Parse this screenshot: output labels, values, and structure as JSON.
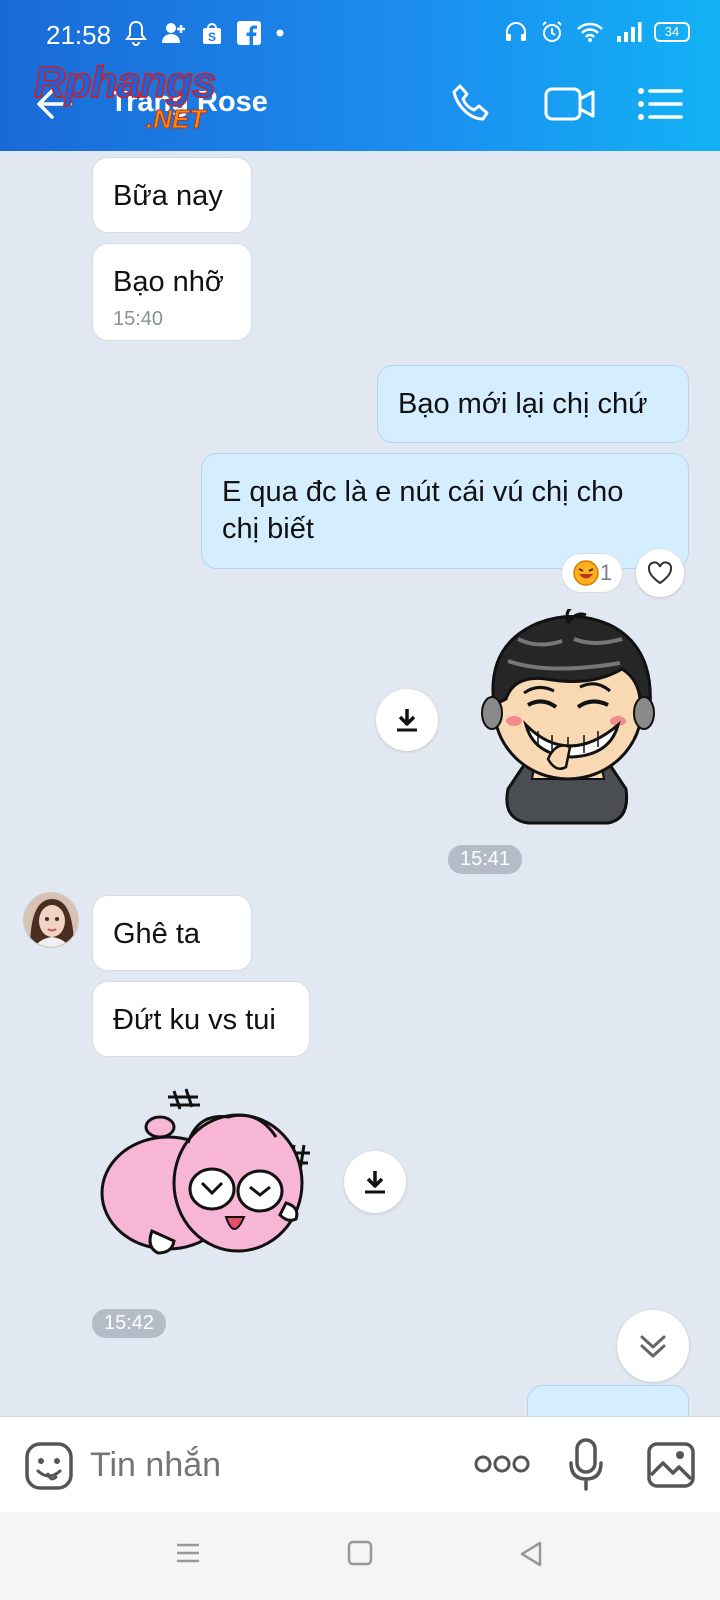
{
  "status_bar": {
    "time": "21:58",
    "battery": "34",
    "left_icons": [
      "bell-icon",
      "add-contact-icon",
      "shopee-icon",
      "facebook-icon",
      "dot-icon"
    ],
    "right_icons": [
      "headset-icon",
      "alarm-icon",
      "wifi-icon",
      "signal-icon",
      "battery-icon"
    ]
  },
  "header": {
    "contact_name": "Trang Rose",
    "watermark_main": "Rphangs",
    "watermark_net": ".NET",
    "accent_color": "#1b8ff0"
  },
  "messages": [
    {
      "text": "Bữa nay",
      "direction": "in"
    },
    {
      "text": "Bạo nhỡ",
      "direction": "in",
      "time": "15:40"
    },
    {
      "text": "Bạo mới lại chị chứ",
      "direction": "out"
    },
    {
      "text": "E qua đc là e nút cái vú chị cho chị biết",
      "direction": "out",
      "reaction_count": "1"
    },
    {
      "type": "sticker",
      "direction": "out",
      "description_icon": "smirking-boy-sticker"
    },
    {
      "type": "time-separator",
      "time": "15:41"
    },
    {
      "text": "Ghê ta",
      "direction": "in"
    },
    {
      "text": "Đứt ku vs tui",
      "direction": "in"
    },
    {
      "type": "sticker",
      "direction": "in",
      "description_icon": "pink-laughing-creature-sticker"
    },
    {
      "type": "time-separator",
      "time": "15:42"
    }
  ],
  "input_bar": {
    "placeholder": "Tin nhắn"
  },
  "colors": {
    "incoming_bubble": "#ffffff",
    "outgoing_bubble": "#d5eeff",
    "chat_background": "#e2e8f1"
  }
}
